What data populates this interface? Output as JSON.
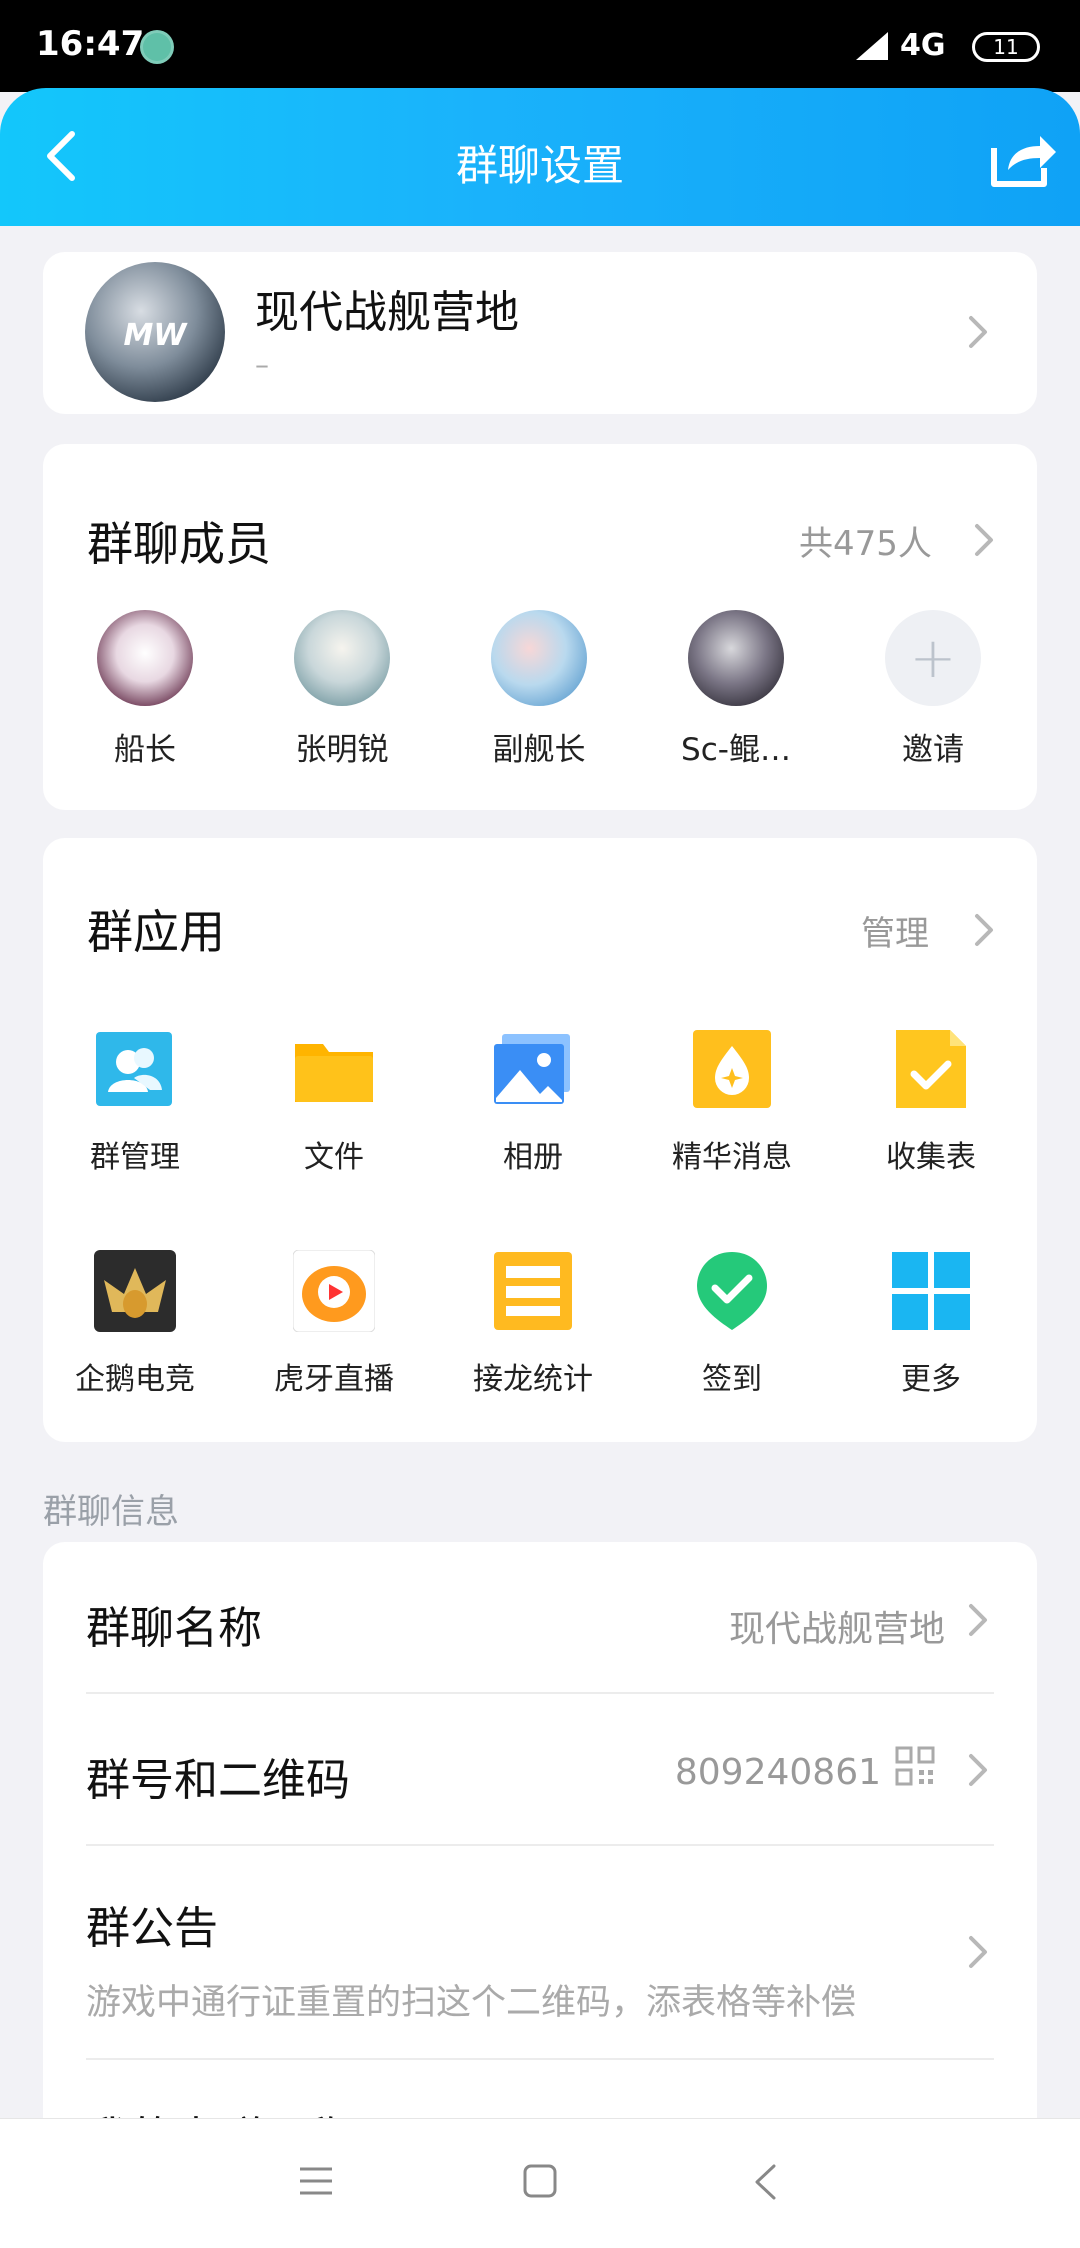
{
  "status_bar": {
    "time": "16:47",
    "network": "4G",
    "battery": "11"
  },
  "header": {
    "title": "群聊设置"
  },
  "group": {
    "avatar_text": "MW",
    "name": "现代战舰营地",
    "subtitle": "–"
  },
  "members": {
    "title": "群聊成员",
    "count": "共475人",
    "items": [
      {
        "label": "船长",
        "color": "#c9a6b8"
      },
      {
        "label": "张明锐",
        "color": "#a9c6cf"
      },
      {
        "label": "副舰长",
        "color": "#9cc6e6"
      },
      {
        "label": "Sc-鲲…",
        "color": "#6f6b76"
      },
      {
        "label": "邀请",
        "icon": "plus-icon"
      }
    ]
  },
  "apps": {
    "title": "群应用",
    "manage": "管理",
    "items": [
      {
        "label": "群管理",
        "icon": "group-manage-icon",
        "color": "#2fb8ea"
      },
      {
        "label": "文件",
        "icon": "folder-icon",
        "color": "#ffc21a"
      },
      {
        "label": "相册",
        "icon": "album-icon",
        "color": "#3a8ef5"
      },
      {
        "label": "精华消息",
        "icon": "essence-icon",
        "color": "#ffbf1d"
      },
      {
        "label": "收集表",
        "icon": "form-icon",
        "color": "#ffc61f"
      },
      {
        "label": "企鹅电竞",
        "icon": "penguin-esports-icon",
        "color": "#2c2c2c"
      },
      {
        "label": "虎牙直播",
        "icon": "huya-icon",
        "color": "#ff9a1e"
      },
      {
        "label": "接龙统计",
        "icon": "relay-icon",
        "color": "#ffba20"
      },
      {
        "label": "签到",
        "icon": "checkin-icon",
        "color": "#25c97a"
      },
      {
        "label": "更多",
        "icon": "more-grid-icon",
        "color": "#1ab6f2"
      }
    ]
  },
  "info": {
    "section_label": "群聊信息",
    "name_label": "群聊名称",
    "name_value": "现代战舰营地",
    "id_label": "群号和二维码",
    "id_value": "809240861",
    "notice_label": "群公告",
    "notice_value": "游戏中通行证重置的扫这个二维码，添表格等补偿",
    "next_label": "我的本群昵称"
  }
}
